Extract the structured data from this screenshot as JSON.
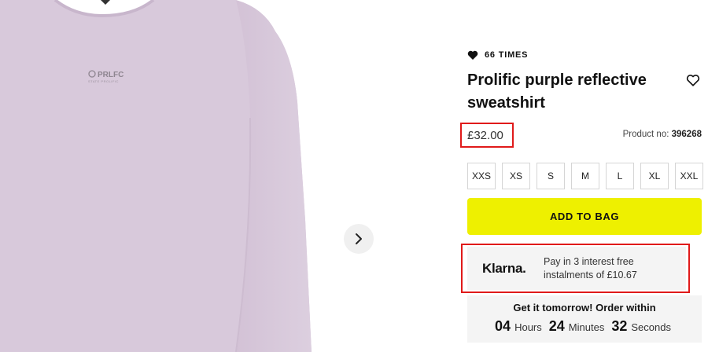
{
  "product": {
    "likes": "66 TIMES",
    "title": "Prolific purple reflective sweatshirt",
    "price": "£32.00",
    "product_no_label": "Product no:",
    "product_no": "396268",
    "garment_print": "PRLFC",
    "garment_print_sub": "STATE PROLIFIC"
  },
  "sizes": [
    "XXS",
    "XS",
    "S",
    "M",
    "L",
    "XL",
    "XXL"
  ],
  "add_to_bag_label": "ADD TO BAG",
  "klarna": {
    "logo": "Klarna.",
    "line1": "Pay in 3 interest free",
    "line2": "instalments of £10.67"
  },
  "delivery": {
    "heading": "Get it tomorrow! Order within",
    "hours": "04",
    "hours_label": "Hours",
    "minutes": "24",
    "minutes_label": "Minutes",
    "seconds": "32",
    "seconds_label": "Seconds"
  },
  "icons": {
    "likes": "heart-filled-icon",
    "wishlist": "heart-outline-icon",
    "next": "chevron-right-icon"
  },
  "colors": {
    "accent": "#eef000",
    "highlight": "#e01a1a",
    "garment": "#d8c9db"
  }
}
